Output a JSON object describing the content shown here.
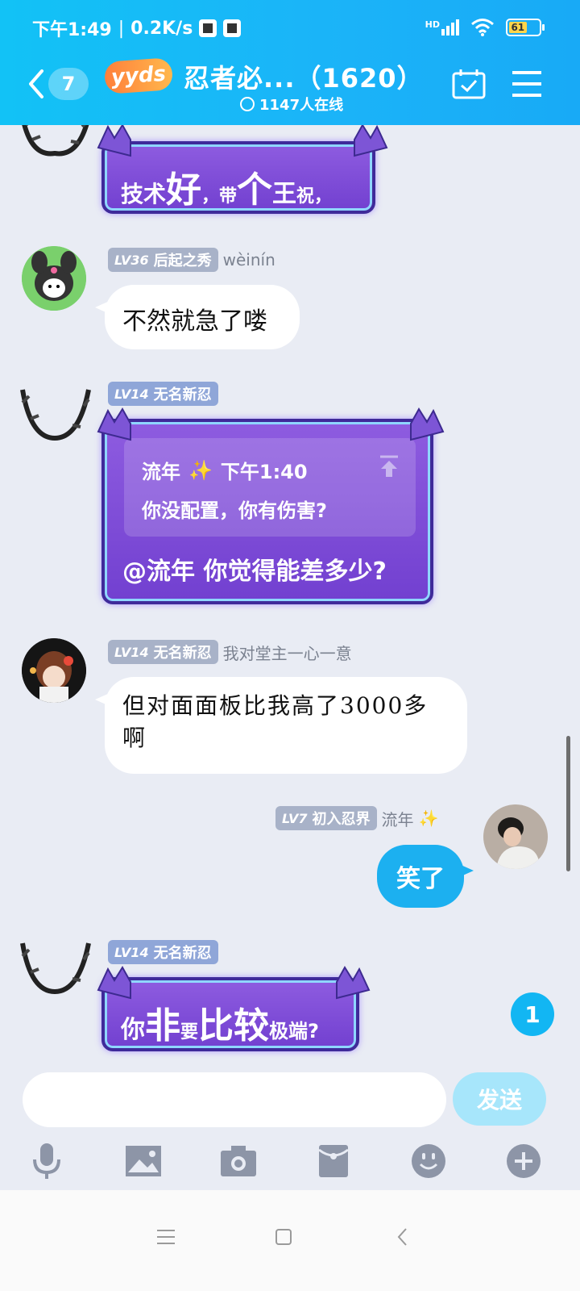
{
  "status_bar": {
    "time": "下午1:49",
    "speed": "0.2K/s",
    "network": "HD",
    "battery": "61"
  },
  "header": {
    "back_count": "7",
    "badge": "yyds",
    "title": "忍者必...（1620）",
    "online": "1147人在线"
  },
  "messages": [
    {
      "type": "purple",
      "segments": [
        {
          "text": "技术",
          "size": "small"
        },
        {
          "text": "好",
          "size": "big"
        },
        {
          "text": "，带",
          "size": "small"
        },
        {
          "text": "个",
          "size": "big"
        },
        {
          "text": "王",
          "size": "mid"
        },
        {
          "text": "祝，",
          "size": "small"
        }
      ]
    },
    {
      "type": "white",
      "lv": "LV36",
      "rank": "后起之秀",
      "nick": "wèinín",
      "text": "不然就急了喽"
    },
    {
      "type": "purple-quote",
      "lv": "LV14",
      "rank": "无名新忍",
      "quote_author": "流年",
      "quote_time": "下午1:40",
      "quote_text": "你没配置，你有伤害?",
      "text": "@流年 你觉得能差多少?"
    },
    {
      "type": "white",
      "lv": "LV14",
      "rank": "无名新忍",
      "nick": "我对堂主一心一意",
      "text_line1": "但对面面板比我高了3000多",
      "text_line2": "啊"
    },
    {
      "type": "self",
      "lv": "LV7",
      "rank": "初入忍界",
      "nick": "流年",
      "text": "笑了"
    },
    {
      "type": "purple",
      "lv": "LV14",
      "rank": "无名新忍",
      "segments": [
        {
          "text": "你",
          "size": "mid"
        },
        {
          "text": "非",
          "size": "big"
        },
        {
          "text": "要",
          "size": "small"
        },
        {
          "text": "比较",
          "size": "big"
        },
        {
          "text": "极端?",
          "size": "small"
        }
      ]
    }
  ],
  "unread_count": "1",
  "input": {
    "placeholder": "",
    "send_label": "发送"
  },
  "toolbar_icons": [
    "microphone-icon",
    "image-icon",
    "camera-icon",
    "red-packet-icon",
    "emoji-icon",
    "plus-icon"
  ],
  "colors": {
    "header": "#12c2f6",
    "purple_bubble": "#7a48d8",
    "self_bubble": "#1cb0f0",
    "background": "#e9ecf4"
  }
}
